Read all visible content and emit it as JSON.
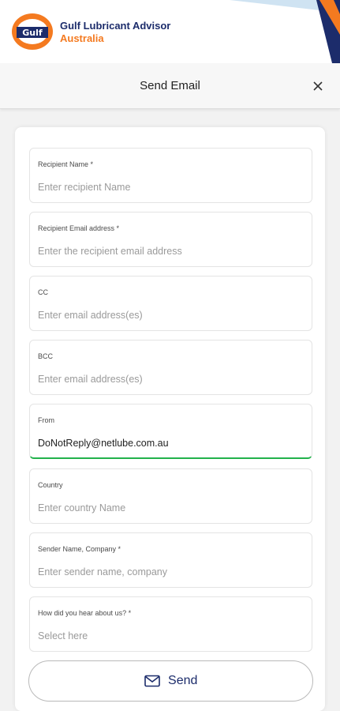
{
  "brand": {
    "logo_text": "Gulf",
    "name": "Gulf Lubricant Advisor",
    "region": "Australia",
    "colors": {
      "navy": "#1c2c6b",
      "orange": "#f47a20",
      "light_blue": "#cfe3f2"
    }
  },
  "header": {
    "title": "Send Email",
    "close_icon": "close-icon"
  },
  "form": {
    "fields": [
      {
        "label": "Recipient Name *",
        "placeholder": "Enter recipient Name",
        "value": ""
      },
      {
        "label": "Recipient Email address *",
        "placeholder": "Enter the recipient email address",
        "value": ""
      },
      {
        "label": "CC",
        "placeholder": "Enter email address(es)",
        "value": ""
      },
      {
        "label": "BCC",
        "placeholder": "Enter email address(es)",
        "value": ""
      },
      {
        "label": "From",
        "placeholder": "",
        "value": "DoNotReply@netlube.com.au"
      },
      {
        "label": "Country",
        "placeholder": "Enter country Name",
        "value": ""
      },
      {
        "label": "Sender Name, Company *",
        "placeholder": "Enter sender name, company",
        "value": ""
      },
      {
        "label": "How did you hear about us? *",
        "placeholder": "Select here",
        "value": ""
      }
    ],
    "active_field_color": "#22b24c",
    "send_label": "Send",
    "send_icon": "mail-icon"
  }
}
